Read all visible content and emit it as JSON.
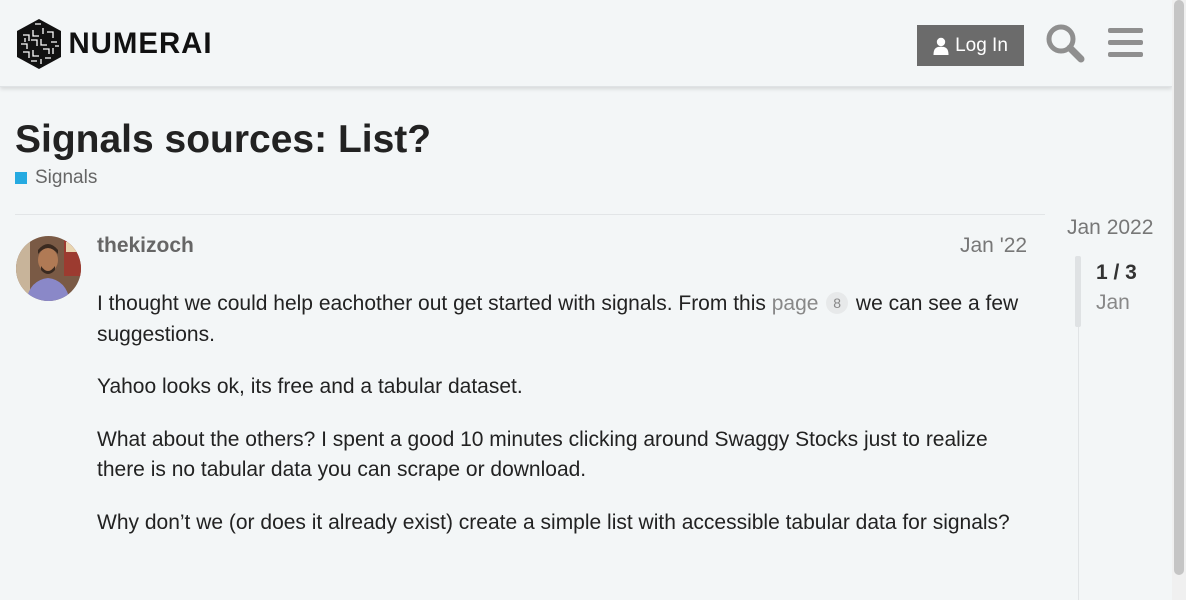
{
  "header": {
    "logo_text": "NUMERAI",
    "login_label": "Log In",
    "login_icon": "user-icon",
    "search_icon": "search-icon",
    "menu_icon": "hamburger-menu-icon"
  },
  "topic": {
    "title": "Signals sources: List?",
    "category": "Signals",
    "category_color": "#25aae1"
  },
  "post": {
    "username": "thekizoch",
    "date": "Jan '22",
    "paragraphs": [
      {
        "before": "I thought we could help eachother out get started with signals. From this ",
        "link": "page",
        "link_count": "8",
        "after": " we can see a few suggestions."
      },
      {
        "text": "Yahoo looks ok, its free and a tabular dataset."
      },
      {
        "text": "What about the others? I spent a good 10 minutes clicking around Swaggy Stocks just to realize there is no tabular data you can scrape or download."
      },
      {
        "text": "Why don’t we (or does it already exist) create a simple list with accessible tabular data for signals?"
      }
    ]
  },
  "timeline": {
    "date": "Jan 2022",
    "position": "1 / 3",
    "sub": "Jan"
  },
  "colors": {
    "background": "#f3f6f7",
    "button": "#6b6b6b",
    "category": "#25aae1"
  }
}
